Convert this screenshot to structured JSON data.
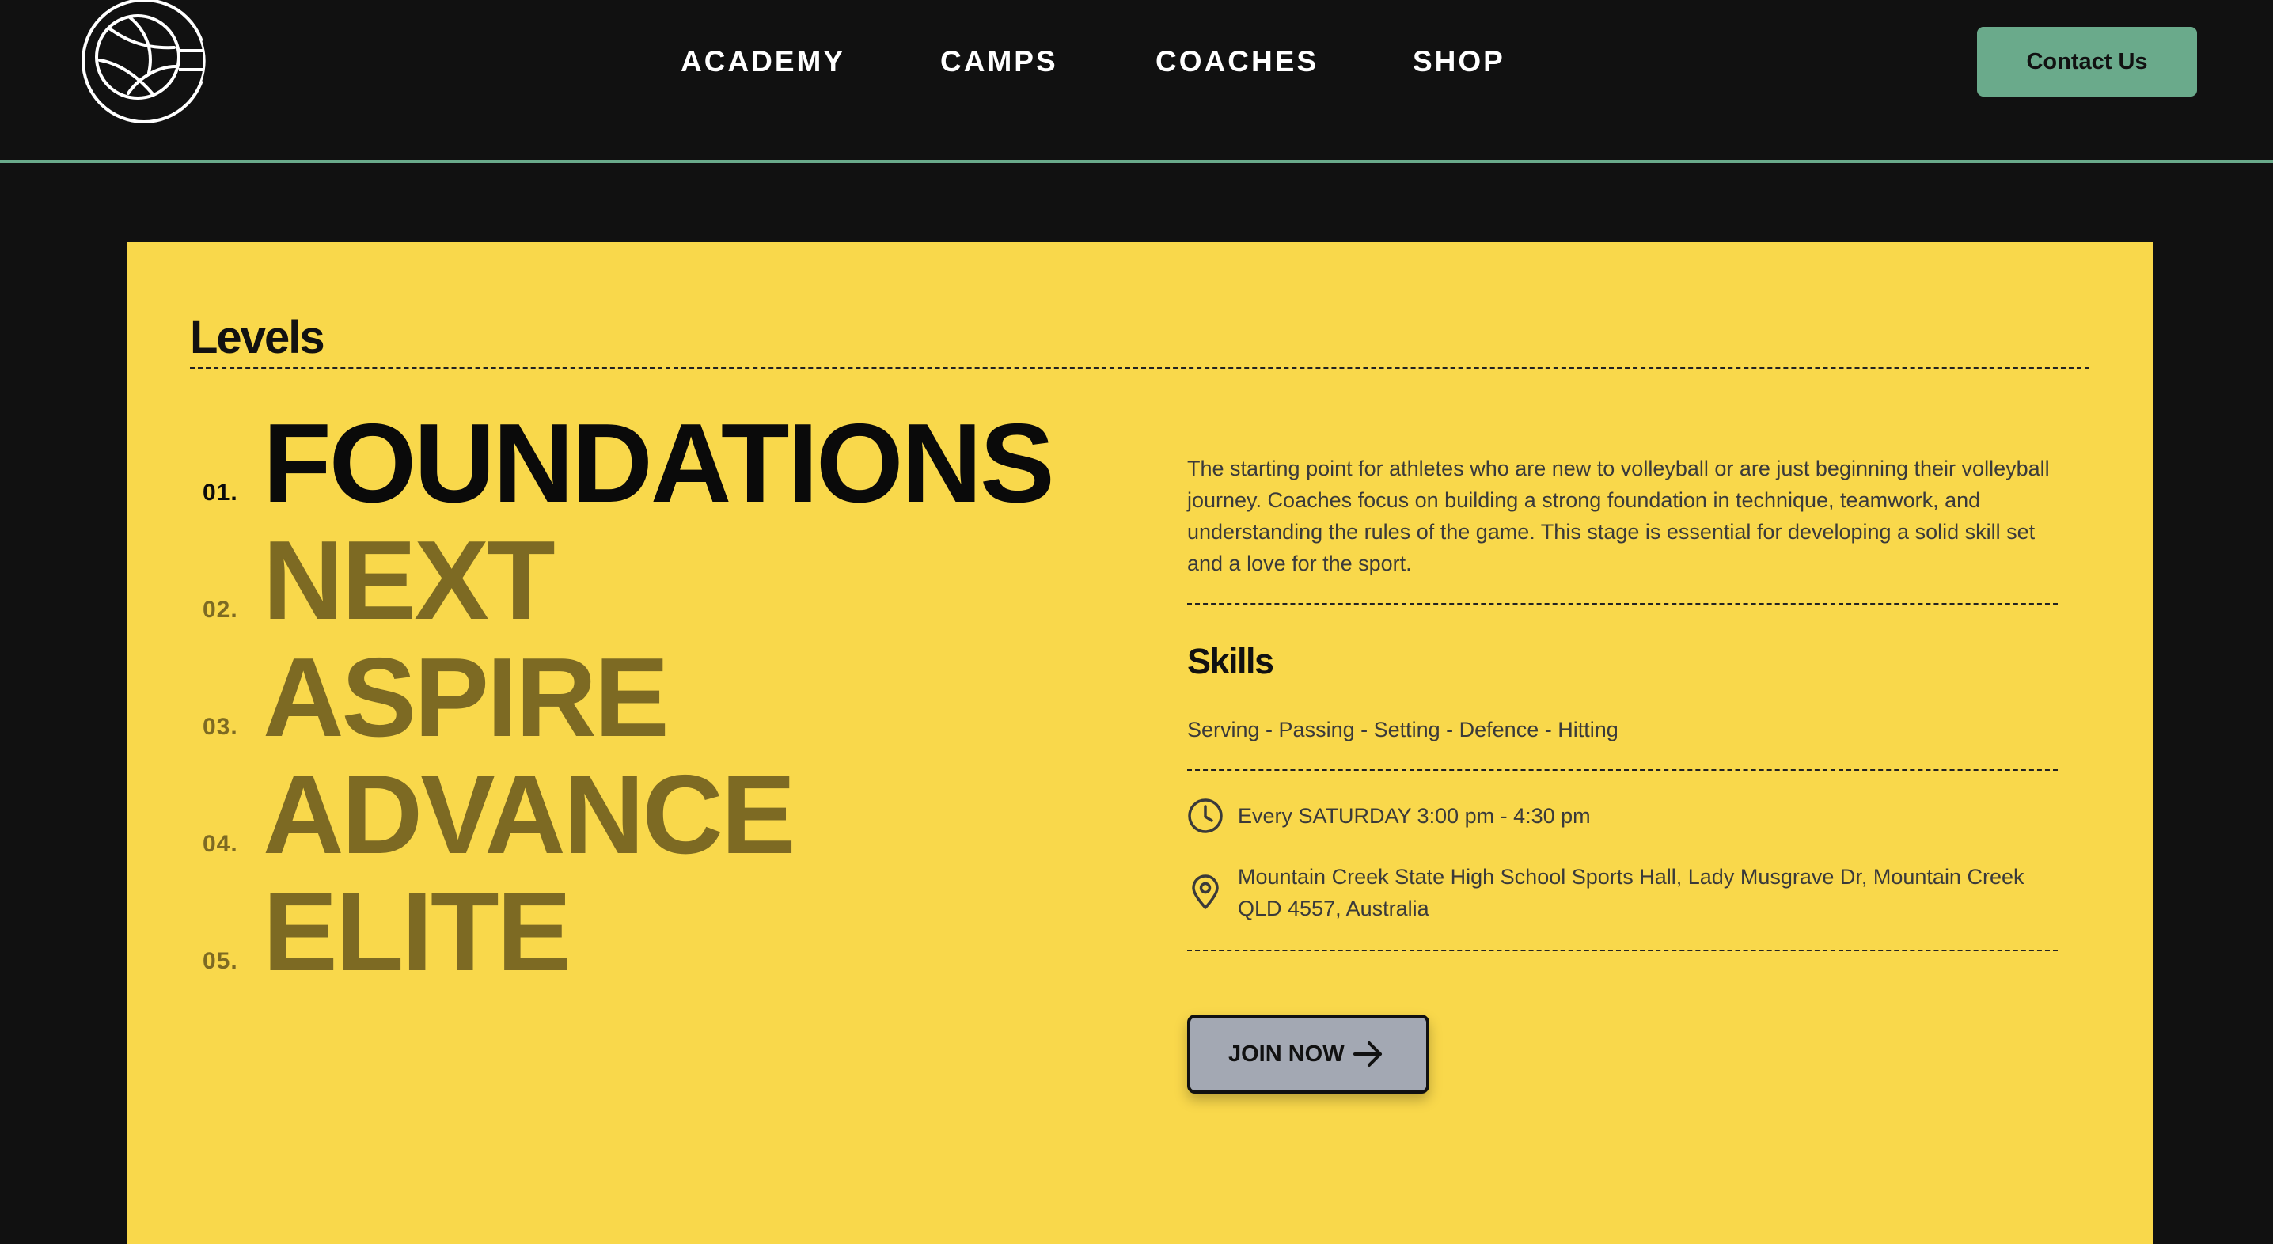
{
  "brand": {
    "logo_icon": "volleyball-logo-icon",
    "accent_color": "#6aaa8b",
    "card_color": "#f9d84b"
  },
  "nav": {
    "items": [
      {
        "label": "ACADEMY"
      },
      {
        "label": "CAMPS"
      },
      {
        "label": "COACHES"
      },
      {
        "label": "SHOP"
      }
    ],
    "contact_label": "Contact Us"
  },
  "levels": {
    "heading": "Levels",
    "items": [
      {
        "num": "01.",
        "name": "FOUNDATIONS",
        "active": true
      },
      {
        "num": "02.",
        "name": "NEXT",
        "active": false
      },
      {
        "num": "03.",
        "name": "ASPIRE",
        "active": false
      },
      {
        "num": "04.",
        "name": "ADVANCE",
        "active": false
      },
      {
        "num": "05.",
        "name": "ELITE",
        "active": false
      }
    ]
  },
  "detail": {
    "description": "The starting point for athletes who are new to volleyball or are just beginning their volleyball journey. Coaches focus on building a strong foundation in technique, teamwork, and understanding the rules of the game. This stage is essential for developing a solid skill set and a love for the sport.",
    "skills_heading": "Skills",
    "skills": "Serving - Passing - Setting - Defence - Hitting",
    "schedule": "Every SATURDAY 3:00 pm - 4:30 pm",
    "schedule_icon": "clock-icon",
    "location": "Mountain Creek State High School Sports Hall, Lady Musgrave Dr, Mountain Creek QLD 4557, Australia",
    "location_icon": "map-pin-icon",
    "join_label": "JOIN NOW",
    "join_icon": "arrow-right-icon"
  }
}
